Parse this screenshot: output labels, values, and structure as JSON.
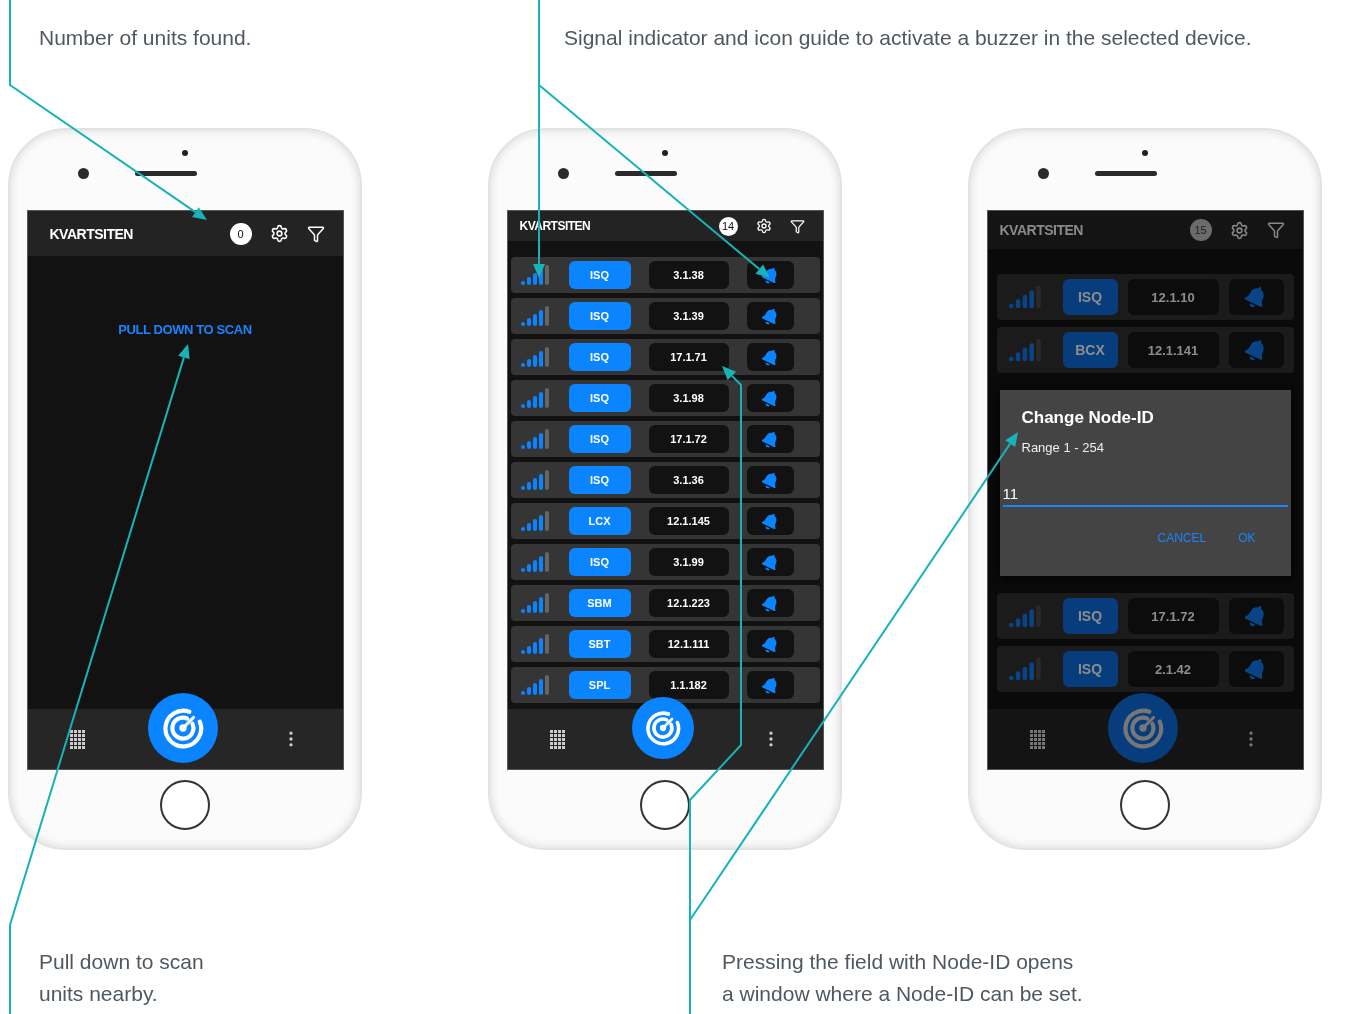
{
  "annotations_top": [
    {
      "text": "Number of units found."
    },
    {
      "text": "Signal indicator and icon guide to activate a buzzer in the selected device."
    }
  ],
  "phones": [
    {
      "kind": "empty",
      "title": "KVARTSITEN",
      "count": "0",
      "message": "PULL DOWN TO SCAN"
    },
    {
      "kind": "list",
      "title": "KVARTSITEN",
      "count": "14",
      "rows": [
        {
          "type": "ISQ",
          "node_id": "3.1.38"
        },
        {
          "type": "ISQ",
          "node_id": "3.1.39"
        },
        {
          "type": "ISQ",
          "node_id": "17.1.71"
        },
        {
          "type": "ISQ",
          "node_id": "3.1.98"
        },
        {
          "type": "ISQ",
          "node_id": "17.1.72"
        },
        {
          "type": "ISQ",
          "node_id": "3.1.36"
        },
        {
          "type": "LCX",
          "node_id": "12.1.145"
        },
        {
          "type": "ISQ",
          "node_id": "3.1.99"
        },
        {
          "type": "SBM",
          "node_id": "12.1.223"
        },
        {
          "type": "SBT",
          "node_id": "12.1.111"
        },
        {
          "type": "SPL",
          "node_id": "1.1.182"
        }
      ]
    },
    {
      "kind": "dialog",
      "title": "KVARTSITEN",
      "count": "15",
      "rows_above": [
        {
          "type": "ISQ",
          "node_id": "12.1.10"
        },
        {
          "type": "BCX",
          "node_id": "12.1.141"
        }
      ],
      "dialog": {
        "title": "Change Node-ID",
        "subtitle": "Range 1 - 254",
        "value": "11",
        "buttons": [
          "CANCEL",
          "OK"
        ]
      },
      "rows_below": [
        {
          "type": "ISQ",
          "node_id": "17.1.72"
        },
        {
          "type": "ISQ",
          "node_id": "2.1.42"
        }
      ]
    }
  ],
  "annotations_bottom": [
    {
      "text": "Pull down to scan\nunits nearby."
    },
    {
      "text": "Pressing the field with Node-ID opens\na window where a Node-ID can be set."
    }
  ]
}
